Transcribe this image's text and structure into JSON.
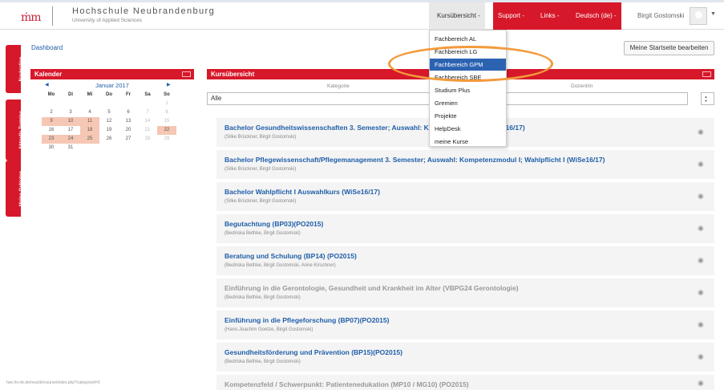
{
  "header": {
    "logo": "ṁm",
    "title": "Hochschule Neubrandenburg",
    "subtitle": "University of Applied Sciences",
    "nav": {
      "kurse": "Kursübersicht -",
      "support": "Support -",
      "links": "Links -",
      "language": "Deutsch (de) -",
      "user": "Birgit Gostomski"
    }
  },
  "side_tabs": [
    "Navigation",
    "Aktuelle Termine",
    "Meine Gebieten"
  ],
  "breadcrumb": "Dashboard",
  "edit_home_button": "Meine Startseite bearbeiten",
  "calendar": {
    "title": "Kalender",
    "month": "Januar 2017",
    "dow": [
      "Mo",
      "Di",
      "Mi",
      "Do",
      "Fr",
      "Sa",
      "So"
    ],
    "cells": [
      "",
      "",
      "",
      "",
      "",
      "",
      "1",
      "2",
      "3",
      "4",
      "5",
      "6",
      "7",
      "8",
      "9",
      "10",
      "11",
      "12",
      "13",
      "14",
      "15",
      "16",
      "17",
      "18",
      "19",
      "20",
      "21",
      "22",
      "23",
      "24",
      "25",
      "26",
      "27",
      "28",
      "29",
      "30",
      "31",
      "",
      "",
      "",
      "",
      ""
    ]
  },
  "kursuebersicht": {
    "title": "Kursübersicht",
    "col_kategorie": "Kategorie",
    "col_dozent": "Dozent/in",
    "filter_value": "Alle",
    "courses": [
      {
        "title": "Bachelor Gesundheitswissenschaften 3. Semester; Auswahl: Kompetenzmodul I (WiSe16/17)",
        "teachers": "(Silke Brückner, Birgit Gostomski)"
      },
      {
        "title": "Bachelor Pflegewissenschaft/Pflegemanagement 3. Semester; Auswahl: Kompetenzmodul I; Wahlpflicht I (WiSe16/17)",
        "teachers": "(Silke Brückner, Birgit Gostomski)"
      },
      {
        "title": "Bachelor Wahlpflicht I Auswahlkurs (WiSe16/17)",
        "teachers": "(Silke Brückner, Birgit Gostomski)"
      },
      {
        "title": "Begutachtung (BP03)(PO2015)",
        "teachers": "(Bedriska Bethke, Birgit Gostomski)"
      },
      {
        "title": "Beratung und Schulung (BP14) (PO2015)",
        "teachers": "(Bedriska Bethke, Birgit Gostomski, Anne Kirschner)"
      },
      {
        "title": "Einführung in die Gerontologie, Gesundheit und Krankheit im Alter (VBPG24 Gerontologie)",
        "teachers": "(Bedriska Bethke, Birgit Gostomski)"
      },
      {
        "title": "Einführung in die Pflegeforschung (BP07)(PO2015)",
        "teachers": "(Hans-Joachim Goetze, Birgit Gostomski)"
      },
      {
        "title": "Gesundheitsförderung und Prävention (BP15)(PO2015)",
        "teachers": "(Bedriska Bethke, Birgit Gostomski)"
      },
      {
        "title": "Kompetenzfeld / Schwerpunkt: Patientenedukation (MP10 / MG10) (PO2015)",
        "teachers": ""
      }
    ]
  },
  "dropdown": {
    "items": [
      "Fachbereich AL",
      "Fachbereich LG",
      "Fachbereich GPM",
      "Fachbereich SBE",
      "Studium Plus",
      "Gremien",
      "Projekte",
      "HelpDesk",
      "meine Kurse"
    ]
  },
  "status_url": "hse.hs-nb.de/neu/de/course/index.php?categoryid=5",
  "colors": {
    "accent": "#d7182a",
    "link": "#1f5ea8",
    "highlight": "#f39a3c",
    "selected": "#2c63b1"
  }
}
